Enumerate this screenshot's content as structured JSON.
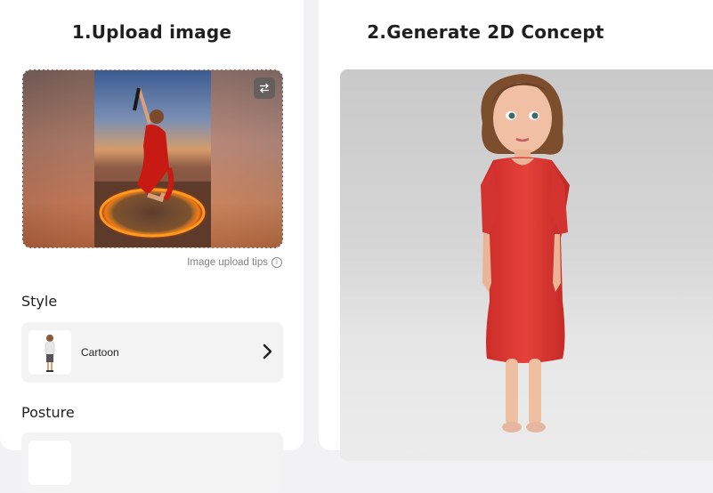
{
  "upload_panel": {
    "title": "1.Upload image",
    "tips_label": "Image upload tips",
    "style_section": {
      "label": "Style",
      "selected": "Cartoon"
    },
    "posture_section": {
      "label": "Posture"
    }
  },
  "result_panel": {
    "title": "2.Generate 2D Concept"
  },
  "icons": {
    "swap": "swap-arrows-icon",
    "info": "info-icon",
    "chevron": "chevron-right-icon"
  },
  "colors": {
    "panel_bg": "#ffffff",
    "page_bg": "#f2f2f4",
    "card_bg": "#f3f3f3",
    "text": "#1f1f1f",
    "muted": "#808080",
    "dress": "#e23a36"
  }
}
